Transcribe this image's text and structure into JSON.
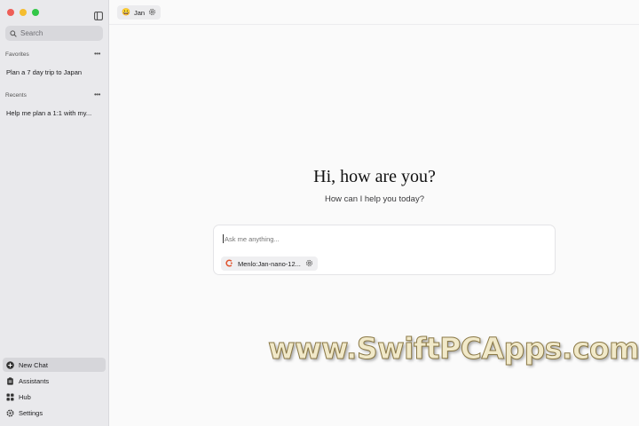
{
  "sidebar": {
    "search_placeholder": "Search",
    "favorites_label": "Favorites",
    "favorites": [
      {
        "label": "Plan a 7 day trip to Japan"
      }
    ],
    "recents_label": "Recents",
    "recents": [
      {
        "label": "Help me plan a 1:1 with my..."
      }
    ],
    "nav": [
      {
        "label": "New Chat",
        "icon": "plus-circle-icon",
        "active": true
      },
      {
        "label": "Assistants",
        "icon": "clipboard-icon"
      },
      {
        "label": "Hub",
        "icon": "grid-icon"
      },
      {
        "label": "Settings",
        "icon": "gear-icon"
      }
    ]
  },
  "topbar": {
    "assistant_emoji": "😀",
    "assistant_name": "Jan"
  },
  "main": {
    "title": "Hi, how are you?",
    "subtitle": "How can I help you today?",
    "composer_placeholder": "Ask me anything...",
    "model_name": "Menlo:Jan-nano-12..."
  },
  "watermark": "www.SwiftPCApps.com",
  "colors": {
    "traffic_red": "#ee5e57",
    "traffic_yellow": "#f5bd2f",
    "traffic_green": "#33c748",
    "model_icon": "#e0532d"
  }
}
